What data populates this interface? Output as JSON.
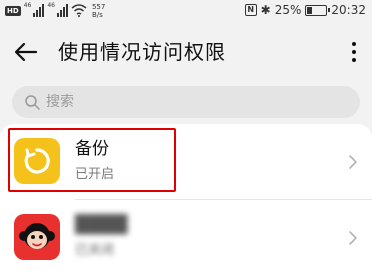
{
  "status_bar": {
    "hd_badge": "HD",
    "sim1_label": "46",
    "sim2_label": "46",
    "net_speed_value": "557",
    "net_speed_unit": "B/s",
    "battery_percent": "25%",
    "battery_level": 0.25,
    "time": "20:32",
    "nfc_label": "N",
    "bt_glyph": "✱"
  },
  "header": {
    "back_glyph": "←",
    "title": "使用情况访问权限",
    "icons": {
      "back": "arrow-left-icon",
      "more": "more-vertical-icon"
    }
  },
  "search": {
    "placeholder": "搜索",
    "value": "",
    "icon": "search-icon"
  },
  "apps": [
    {
      "name": "备份",
      "status": "已开启",
      "icon": "backup-icon",
      "highlighted": true,
      "color": "#f5c21b"
    },
    {
      "name": "",
      "status": "已关闭",
      "icon": "monkey-app-icon",
      "obscured": true,
      "color": "#e8312f"
    }
  ],
  "colors": {
    "highlight_border": "#e00000",
    "background": "#f2f2f2",
    "list_background": "#ffffff"
  }
}
